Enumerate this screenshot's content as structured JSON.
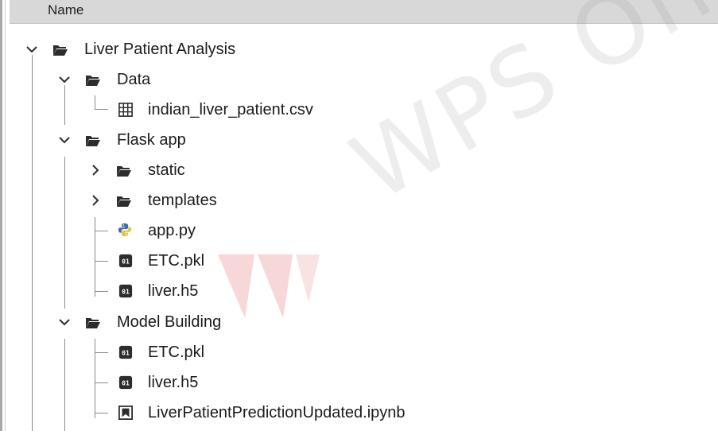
{
  "header": {
    "column_name": "Name"
  },
  "tree": {
    "items": [
      {
        "label": "Liver Patient Analysis",
        "icon": "folder-icon",
        "expanded": true,
        "depth": 0
      },
      {
        "label": "Data",
        "icon": "folder-icon",
        "expanded": true,
        "depth": 1
      },
      {
        "label": "indian_liver_patient.csv",
        "icon": "table-icon",
        "depth": 2
      },
      {
        "label": "Flask app",
        "icon": "folder-icon",
        "expanded": true,
        "depth": 1
      },
      {
        "label": "static",
        "icon": "folder-icon",
        "expanded": false,
        "depth": 2
      },
      {
        "label": "templates",
        "icon": "folder-icon",
        "expanded": false,
        "depth": 2
      },
      {
        "label": "app.py",
        "icon": "python-icon",
        "depth": 2
      },
      {
        "label": "ETC.pkl",
        "icon": "binary-file-icon",
        "depth": 2
      },
      {
        "label": "liver.h5",
        "icon": "binary-file-icon",
        "depth": 2
      },
      {
        "label": "Model Building",
        "icon": "folder-icon",
        "expanded": true,
        "depth": 1
      },
      {
        "label": "ETC.pkl",
        "icon": "binary-file-icon",
        "depth": 2
      },
      {
        "label": "liver.h5",
        "icon": "binary-file-icon",
        "depth": 2
      },
      {
        "label": "LiverPatientPredictionUpdated.ipynb",
        "icon": "notebook-icon",
        "depth": 2
      }
    ]
  },
  "watermark": {
    "text": "WPS Office"
  },
  "colors": {
    "header_bg": "#d8d8d8",
    "tree_line": "#8a8a8a",
    "icon_dark": "#2d2d2d",
    "python_blue": "#3b6da6",
    "python_yellow": "#e8c342",
    "watermark_red": "#e8a0a0"
  }
}
